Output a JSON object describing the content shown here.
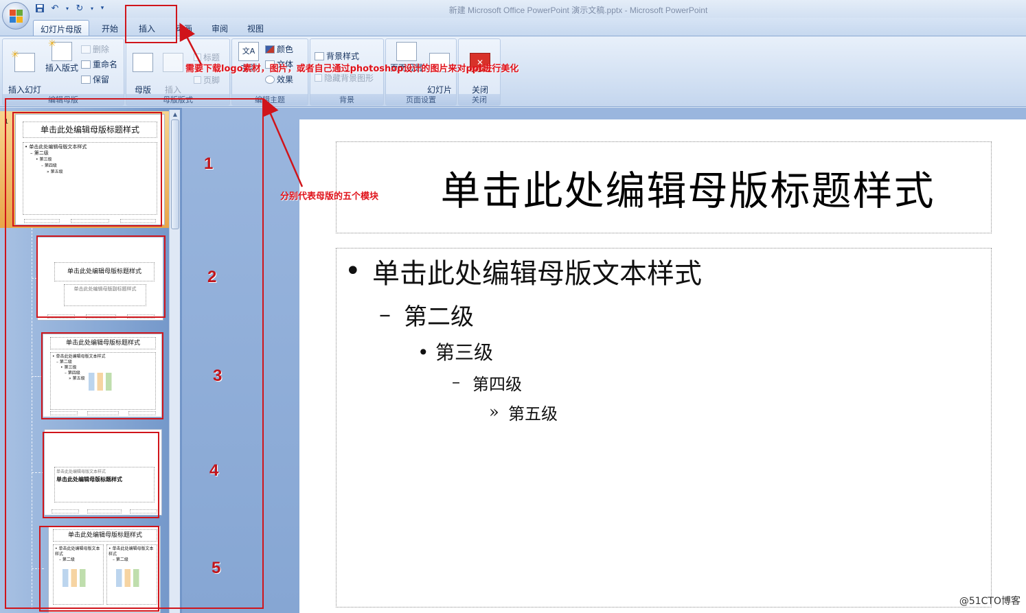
{
  "window": {
    "title": "新建 Microsoft Office PowerPoint 演示文稿.pptx - Microsoft PowerPoint"
  },
  "qat": {
    "customize": "▾"
  },
  "tabs": [
    {
      "label": "幻灯片母版",
      "active": true
    },
    {
      "label": "开始"
    },
    {
      "label": "插入"
    },
    {
      "label": "动画"
    },
    {
      "label": "审阅"
    },
    {
      "label": "视图"
    }
  ],
  "ribbon": {
    "edit_master": {
      "label": "编辑母版",
      "insert_slide_master": "插入幻灯\n片母版",
      "insert_layout": "插入版式",
      "delete": "删除",
      "rename": "重命名",
      "preserve": "保留"
    },
    "master_layout": {
      "label": "母版版式",
      "master_layout_btn": "母版\n版式",
      "insert_placeholder": "插入\n占位符",
      "title_check": "标题",
      "footer_check": "页脚"
    },
    "edit_theme": {
      "label": "编辑主题",
      "themes": "主题",
      "colors": "颜色",
      "fonts": "文体",
      "effects": "效果"
    },
    "background": {
      "label": "背景",
      "bg_styles": "背景样式",
      "hide_bg": "隐藏背景图形"
    },
    "page_setup": {
      "label": "页面设置",
      "page_setup_btn": "页面设置",
      "orientation": "幻灯片\n方向"
    },
    "close": {
      "label": "关闭",
      "close_master": "关闭\n母版视图"
    }
  },
  "thumbnails": {
    "slide_number": "1",
    "master_title": "单击此处编辑母版标题样式",
    "master_text": "单击此处编辑母版文本样式",
    "level2": "第二级",
    "level3": "第三级",
    "level4": "第四级",
    "level5": "第五级",
    "title_slide_subtitle": "单击此处编辑母版副标题样式",
    "section_title": "单击此处编辑母版标题样式"
  },
  "annotations": {
    "insert_note": "需要下载logo素材，图片，或者自己通过photoshop设计的图片来对ppt进行美化",
    "modules_note": "分别代表母版的五个模块",
    "numbers": [
      "1",
      "2",
      "3",
      "4",
      "5"
    ]
  },
  "slide": {
    "title": "单击此处编辑母版标题样式",
    "level1": "单击此处编辑母版文本样式",
    "level2": "第二级",
    "level3": "第三级",
    "level4": "第四级",
    "level5": "第五级",
    "bullet1": "•",
    "bullet2": "–",
    "bullet3": "•",
    "bullet4": "–",
    "bullet5": "»"
  },
  "watermark": "@51CTO博客",
  "colors": {
    "annotation_red": "#d0141a",
    "ribbon_blue": "#d3e1f3",
    "selection_orange": "#e9a549"
  }
}
